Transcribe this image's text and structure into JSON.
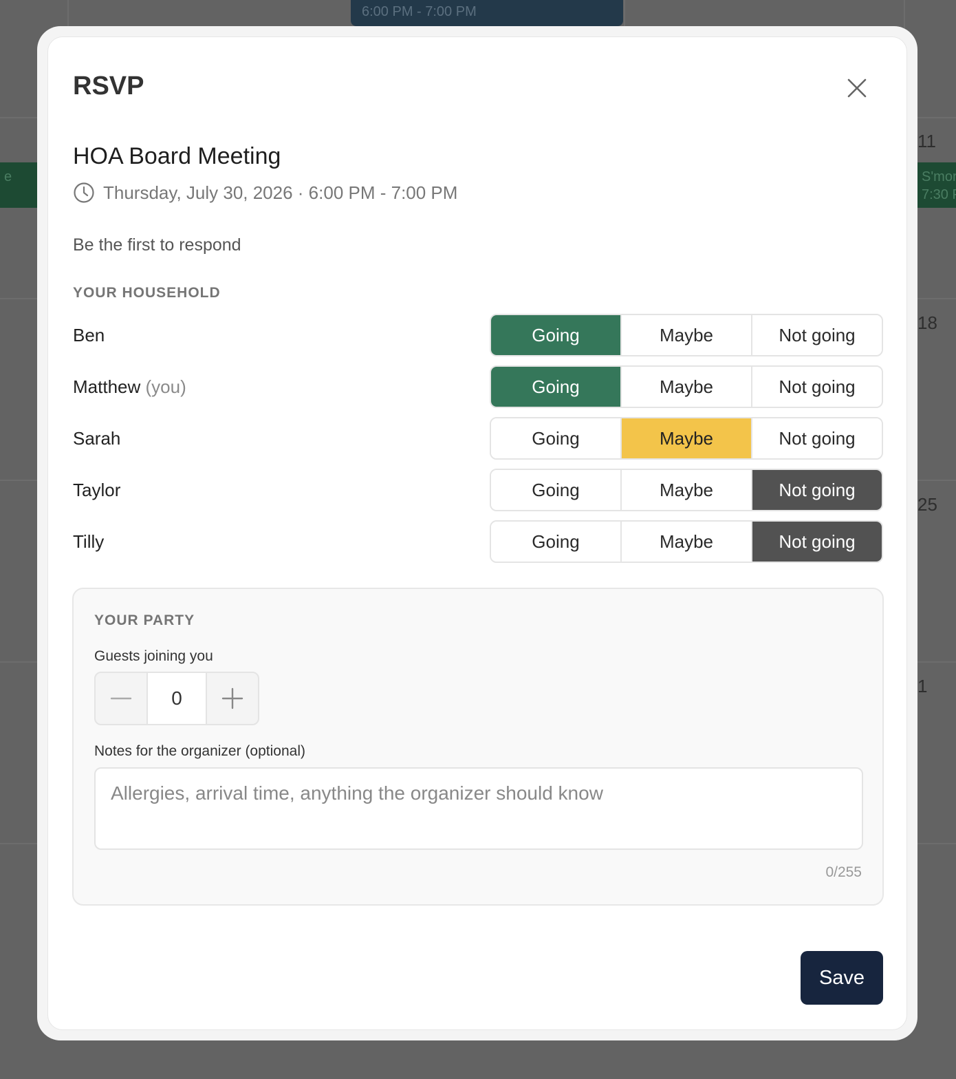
{
  "background": {
    "top_event_time": "6:00 PM - 7:00 PM",
    "left_event_fragment": "e",
    "right_event_fragment": "S'mor",
    "right_event_time_fragment": "7:30 P",
    "day_numbers": [
      "11",
      "18",
      "25",
      "1"
    ]
  },
  "modal": {
    "title": "RSVP",
    "close_icon": "close-icon"
  },
  "event": {
    "title": "HOA Board Meeting",
    "when": "Thursday, July 30, 2026 · 6:00 PM - 7:00 PM",
    "clock_icon": "clock-icon",
    "responses_note": "Be the first to respond"
  },
  "household": {
    "label": "YOUR HOUSEHOLD",
    "options": [
      "Going",
      "Maybe",
      "Not going"
    ],
    "members": [
      {
        "name": "Ben",
        "suffix": "",
        "selected": "Going"
      },
      {
        "name": "Matthew",
        "suffix": "(you)",
        "selected": "Going"
      },
      {
        "name": "Sarah",
        "suffix": "",
        "selected": "Maybe"
      },
      {
        "name": "Taylor",
        "suffix": "",
        "selected": "Not going"
      },
      {
        "name": "Tilly",
        "suffix": "",
        "selected": "Not going"
      }
    ]
  },
  "party": {
    "label": "YOUR PARTY",
    "guests_label": "Guests joining you",
    "guests_value": "0",
    "minus_icon": "minus-icon",
    "plus_icon": "plus-icon",
    "notes_label": "Notes for the organizer (optional)",
    "notes_placeholder": "Allergies, arrival time, anything the organizer should know",
    "notes_value": "",
    "char_count": "0/255"
  },
  "actions": {
    "save_label": "Save"
  },
  "colors": {
    "going": "#35775a",
    "maybe": "#f3c44a",
    "not_going": "#525252",
    "save": "#17253e"
  }
}
